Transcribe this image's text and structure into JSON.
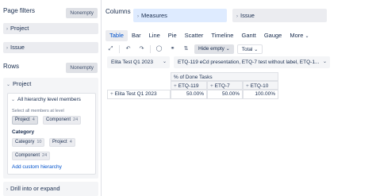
{
  "left_panel": {
    "page_filters_label": "Page filters",
    "page_filters_nonempty": "Nonempty",
    "page_filter_items": [
      "Project",
      "Issue"
    ],
    "rows_label": "Rows",
    "rows_nonempty": "Nonempty",
    "rows_dimension": "Project",
    "hierarchy_box": {
      "title": "All hierarchy level members",
      "subtitle": "Select all members at level",
      "level_chips": [
        {
          "label": "Project",
          "count": "4",
          "selected": true
        },
        {
          "label": "Component",
          "count": "24",
          "selected": false
        }
      ],
      "category_label": "Category",
      "category_chips": [
        {
          "label": "Category",
          "count": "10"
        },
        {
          "label": "Project",
          "count": "4"
        },
        {
          "label": "Component",
          "count": "24"
        }
      ],
      "add_link": "Add custom hierarchy"
    },
    "drill_label": "Drill into or expand"
  },
  "columns": {
    "label": "Columns",
    "items": [
      "Measures",
      "Issue"
    ]
  },
  "tabs": [
    {
      "label": "Table",
      "active": true
    },
    {
      "label": "Bar",
      "active": false
    },
    {
      "label": "Line",
      "active": false
    },
    {
      "label": "Pie",
      "active": false
    },
    {
      "label": "Scatter",
      "active": false
    },
    {
      "label": "Timeline",
      "active": false
    },
    {
      "label": "Gantt",
      "active": false
    },
    {
      "label": "Gauge",
      "active": false
    },
    {
      "label": "More",
      "active": false
    }
  ],
  "toolbar": {
    "icons": [
      "expand-icon",
      "undo-icon",
      "redo-icon",
      "comment-icon",
      "link-icon",
      "sort-icon"
    ],
    "hide_empty_label": "Hide empty",
    "total_label": "Total"
  },
  "page_selectors": {
    "period": "Elita Test Q1 2023",
    "issue": "ETQ-119 eCd presentation, ETQ-7 test without label, ETQ-1..."
  },
  "table": {
    "measure_header": "% of Done Tasks",
    "columns": [
      "ETQ-119",
      "ETQ-7",
      "ETQ-10"
    ],
    "row_label": "Elita Test Q1 2023",
    "values": [
      "50.00%",
      "50.00%",
      "100.00%"
    ]
  },
  "colors": {
    "accent": "#0052cc",
    "measures_bg": "#deebff",
    "chip_bg": "#ebecf0"
  }
}
